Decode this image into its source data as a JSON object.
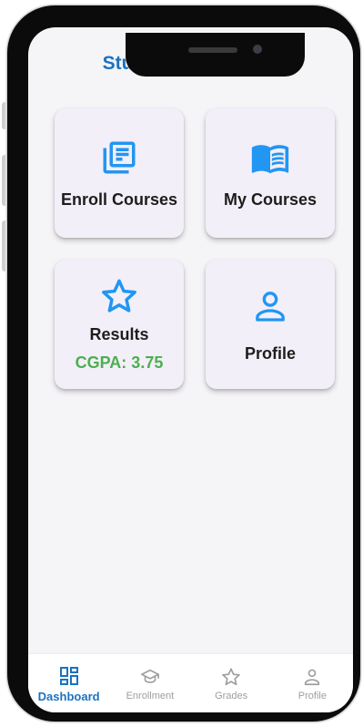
{
  "app": {
    "title": "Student Dashboard"
  },
  "cards": [
    {
      "label": "Enroll Courses",
      "icon": "library-books-icon"
    },
    {
      "label": "My Courses",
      "icon": "open-book-icon"
    },
    {
      "label": "Results",
      "icon": "star-outline-icon",
      "sub": "CGPA: 3.75"
    },
    {
      "label": "Profile",
      "icon": "person-outline-icon"
    }
  ],
  "nav": {
    "items": [
      {
        "label": "Dashboard",
        "icon": "dashboard-icon",
        "active": true
      },
      {
        "label": "Enrollment",
        "icon": "graduation-cap-icon",
        "active": false
      },
      {
        "label": "Grades",
        "icon": "star-outline-icon",
        "active": false
      },
      {
        "label": "Profile",
        "icon": "person-outline-icon",
        "active": false
      }
    ]
  },
  "colors": {
    "accent": "#1a73c0",
    "icon_blue": "#2196f3",
    "success": "#4caf50",
    "card_bg": "#f3eff8",
    "inactive": "#9e9e9e"
  }
}
